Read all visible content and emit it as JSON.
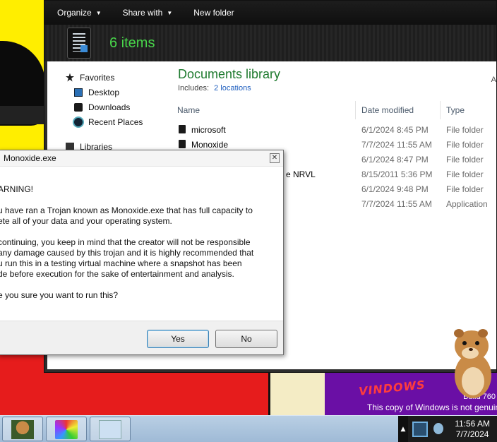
{
  "explorer": {
    "toolbar": {
      "organize": "Organize",
      "share_with": "Share with",
      "new_folder": "New folder"
    },
    "item_count": "6 items",
    "nav": {
      "favorites": "Favorites",
      "desktop": "Desktop",
      "downloads": "Downloads",
      "recent_places": "Recent Places",
      "libraries": "Libraries"
    },
    "library": {
      "title": "Documents library",
      "includes_label": "Includes:",
      "includes_link": "2 locations",
      "arrange": "A"
    },
    "columns": {
      "name": "Name",
      "date_modified": "Date modified",
      "type": "Type"
    },
    "rows": [
      {
        "name": "microsoft",
        "date": "6/1/2024 8:45 PM",
        "type": "File folder"
      },
      {
        "name": "Monoxide",
        "date": "7/7/2024 11:55 AM",
        "type": "File folder"
      },
      {
        "name": "",
        "date": "6/1/2024 8:47 PM",
        "type": "File folder"
      },
      {
        "name": "e NRVL",
        "date": "8/15/2011 5:36 PM",
        "type": "File folder"
      },
      {
        "name": "",
        "date": "6/1/2024 9:48 PM",
        "type": "File folder"
      },
      {
        "name": "",
        "date": "7/7/2024 11:55 AM",
        "type": "Application"
      }
    ]
  },
  "dialog": {
    "title": "Monoxide.exe",
    "close": "✕",
    "warning": "ARNING!",
    "para1": "u have ran a Trojan known as Monoxide.exe that has full capacity to\nete all of your data and your operating system.",
    "para2": "continuing, you keep in mind that the creator will not be responsible\nany damage caused by this trojan and it is highly recommended that\nu run this in a testing virtual machine where a snapshot has been\nde before execution for the sake of entertainment and analysis.",
    "question": "e you sure you want to run this?",
    "yes": "Yes",
    "no": "No"
  },
  "desktop": {
    "distorted_text": "VINDOWS",
    "build": "Build 760",
    "genuine": "This copy of Windows is not genuine"
  },
  "taskbar": {
    "tray_arrow": "▲",
    "time": "11:56 AM",
    "date": "7/7/2024"
  },
  "icons": {
    "favorites": "star-icon",
    "desktop": "desktop-icon",
    "downloads": "downloads-icon",
    "recent": "recent-places-icon",
    "libraries": "library-icon",
    "folder": "folder-icon"
  },
  "colors": {
    "library_title": "#1e7a2e",
    "item_count": "#48d64a",
    "link": "#1f5fbf",
    "desktop_red": "#e61c1c",
    "desktop_purple": "#6a0fa5",
    "desktop_yellow": "#ffee00"
  }
}
